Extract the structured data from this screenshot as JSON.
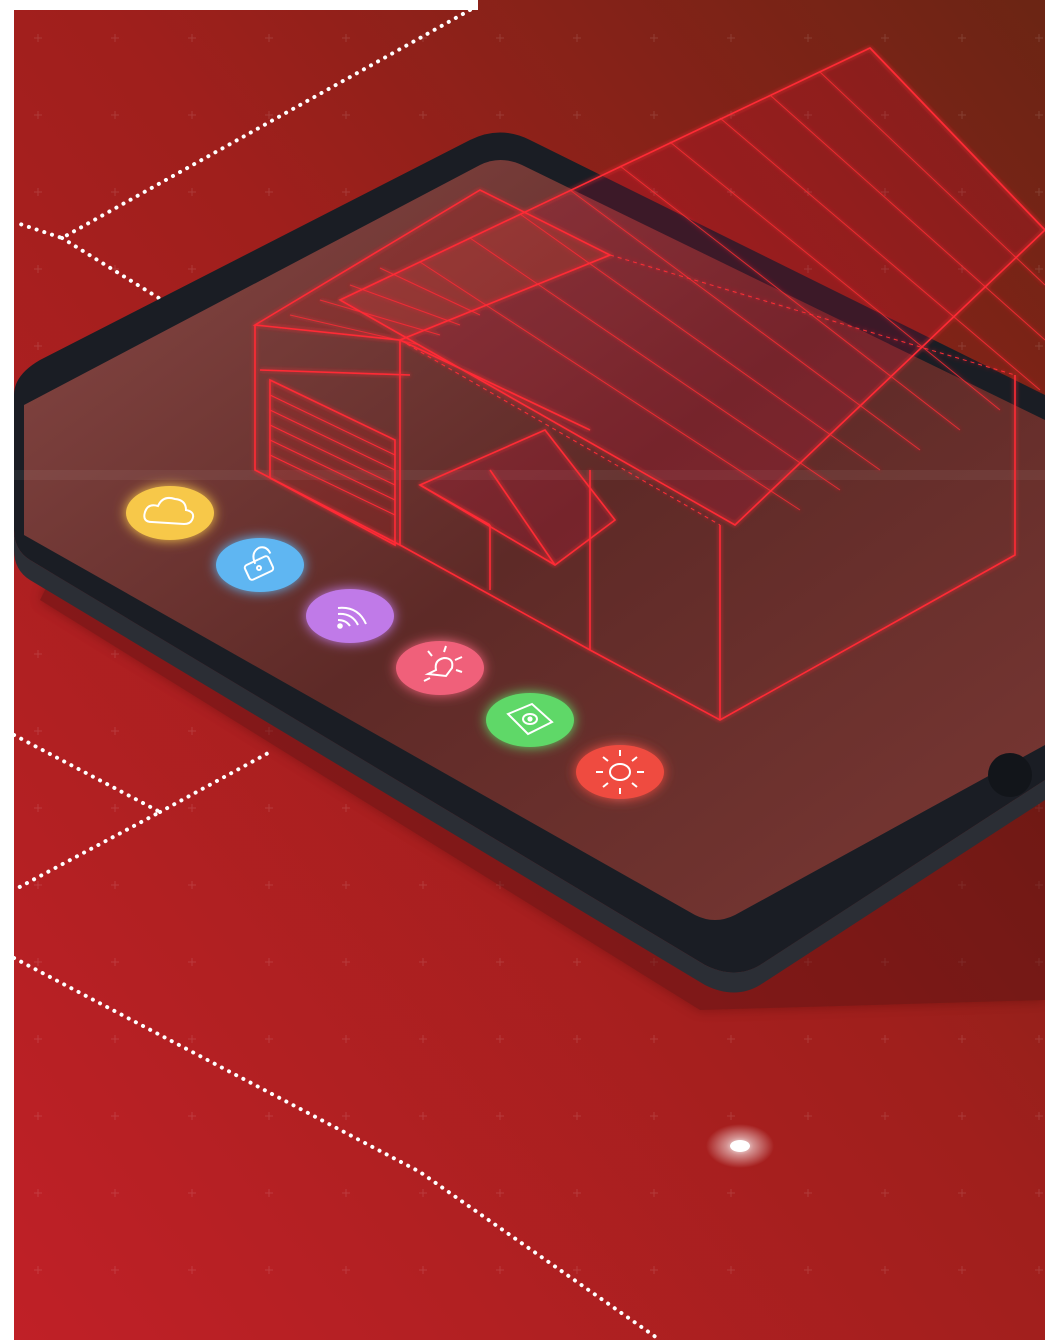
{
  "illustration": {
    "subject": "smart-home-tablet",
    "background_color": "#b3201f",
    "background_color_dark": "#6e2214",
    "tablet_frame_color": "#1b1f26",
    "screen_color": "#5c2a25",
    "hologram_color": "#ff2a35",
    "dot_line_color": "#ffffff"
  },
  "app_icons": [
    {
      "name": "cloud-icon",
      "color": "#f7c84a"
    },
    {
      "name": "lock-icon",
      "color": "#5fb6f2"
    },
    {
      "name": "wifi-icon",
      "color": "#c07ae8"
    },
    {
      "name": "lightbulb-icon",
      "color": "#f0607a"
    },
    {
      "name": "camera-icon",
      "color": "#5fd867"
    },
    {
      "name": "sun-icon",
      "color": "#ef4b3f"
    }
  ]
}
